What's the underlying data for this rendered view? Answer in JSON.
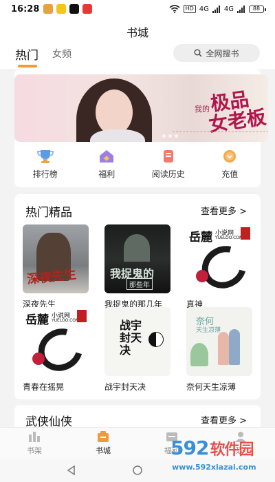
{
  "status_bar": {
    "time": "16:28",
    "hd_label": "HD",
    "signal_label": "4G",
    "battery": "88"
  },
  "header": {
    "title": "书城",
    "tabs": [
      "热门",
      "女频"
    ],
    "search_label": "全网搜书",
    "accent_color": "#f29a3a"
  },
  "banner": {
    "title_line1": "极品",
    "title_line2": "女老板",
    "small_text": "我的"
  },
  "shortcuts": [
    {
      "label": "排行榜",
      "icon": "trophy-icon"
    },
    {
      "label": "福利",
      "icon": "gift-house-icon"
    },
    {
      "label": "阅读历史",
      "icon": "reading-history-icon"
    },
    {
      "label": "充值",
      "icon": "coin-icon"
    }
  ],
  "hot_section": {
    "title": "热门精品",
    "more": "查看更多 >",
    "books": [
      {
        "title": "深夜先生",
        "cover_text": "深夜先生"
      },
      {
        "title": "我捉鬼的那几年",
        "cover_text": "我捉鬼的",
        "cover_sub": "那些年"
      },
      {
        "title": "真神",
        "cover_text": "岳麓",
        "cover_sub": "小说网",
        "cover_url": "YUELOO.COM"
      },
      {
        "title": "青春在摇晃",
        "cover_text": "岳麓",
        "cover_sub": "小说网",
        "cover_url": "YUELOO.COM"
      },
      {
        "title": "战宇封天决",
        "cover_text": "战宇封天决"
      },
      {
        "title": "奈何天生凉薄",
        "cover_text": "奈何",
        "cover_sub": "天生凉薄"
      }
    ]
  },
  "wuxia_section": {
    "title": "武侠仙侠",
    "more": "查看更多 >"
  },
  "bottom_nav": [
    {
      "label": "书架",
      "active": false
    },
    {
      "label": "书城",
      "active": true
    },
    {
      "label": "福利",
      "active": false
    },
    {
      "label": "我的",
      "active": false
    }
  ],
  "watermark": {
    "brand_num": "592",
    "brand_cn": "软件园",
    "url": "www.592xiazai.com"
  }
}
